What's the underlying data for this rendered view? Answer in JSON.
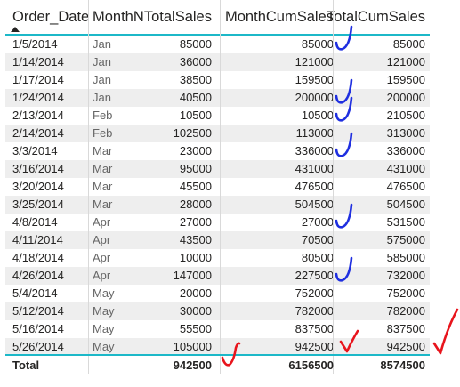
{
  "table": {
    "columns": [
      "Order_Date",
      "MonthN",
      "TotalSales",
      "MonthCumSales",
      "TotalCumSales"
    ],
    "sort_column": "Order_Date",
    "rows": [
      [
        "1/5/2014",
        "Jan",
        "85000",
        "85000",
        "85000"
      ],
      [
        "1/14/2014",
        "Jan",
        "36000",
        "121000",
        "121000"
      ],
      [
        "1/17/2014",
        "Jan",
        "38500",
        "159500",
        "159500"
      ],
      [
        "1/24/2014",
        "Jan",
        "40500",
        "200000",
        "200000"
      ],
      [
        "2/13/2014",
        "Feb",
        "10500",
        "10500",
        "210500"
      ],
      [
        "2/14/2014",
        "Feb",
        "102500",
        "113000",
        "313000"
      ],
      [
        "3/3/2014",
        "Mar",
        "23000",
        "336000",
        "336000"
      ],
      [
        "3/16/2014",
        "Mar",
        "95000",
        "431000",
        "431000"
      ],
      [
        "3/20/2014",
        "Mar",
        "45500",
        "476500",
        "476500"
      ],
      [
        "3/25/2014",
        "Mar",
        "28000",
        "504500",
        "504500"
      ],
      [
        "4/8/2014",
        "Apr",
        "27000",
        "27000",
        "531500"
      ],
      [
        "4/11/2014",
        "Apr",
        "43500",
        "70500",
        "575000"
      ],
      [
        "4/18/2014",
        "Apr",
        "10000",
        "80500",
        "585000"
      ],
      [
        "4/26/2014",
        "Apr",
        "147000",
        "227500",
        "732000"
      ],
      [
        "5/4/2014",
        "May",
        "20000",
        "752000",
        "752000"
      ],
      [
        "5/12/2014",
        "May",
        "30000",
        "782000",
        "782000"
      ],
      [
        "5/16/2014",
        "May",
        "55500",
        "837500",
        "837500"
      ],
      [
        "5/26/2014",
        "May",
        "105000",
        "942500",
        "942500"
      ]
    ],
    "total": {
      "label": "Total",
      "month": "",
      "total_sales": "942500",
      "month_cum_sales": "6156500",
      "total_cum_sales": "8574500"
    }
  },
  "annotations": {
    "blue_checkmark_rows": [
      0,
      3,
      4,
      6,
      10,
      13
    ],
    "red_checkmark_rows": [
      17
    ],
    "red_checkmark_total_sales": true,
    "blue_color": "#1f2fe0",
    "red_color": "#e8141c"
  },
  "colors": {
    "accent_line": "#1cb8c8",
    "alt_row": "#eeeeee",
    "text": "#252423",
    "month_text": "#666666"
  }
}
